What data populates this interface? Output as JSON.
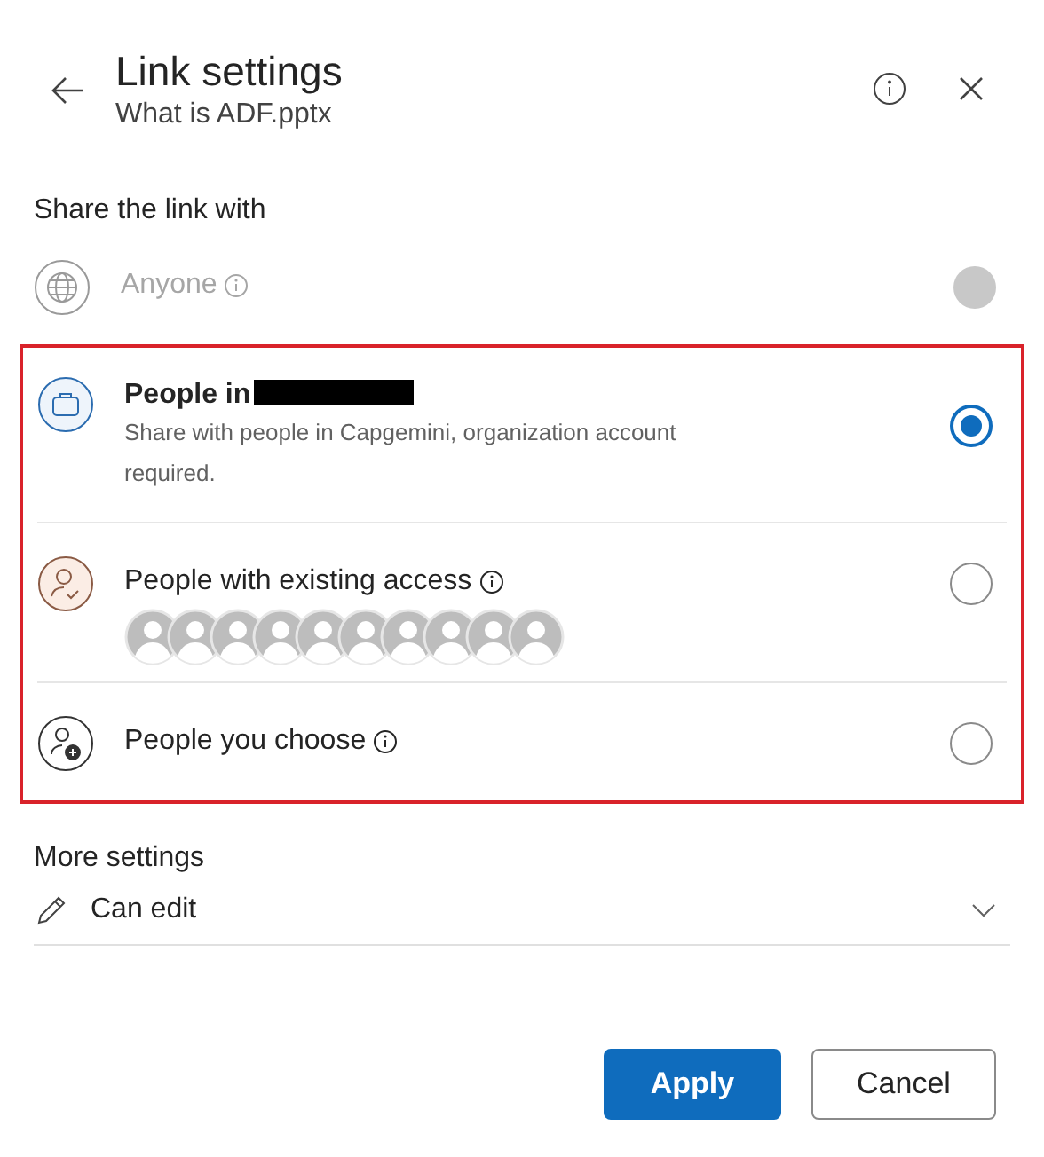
{
  "header": {
    "title": "Link settings",
    "subtitle": "What is ADF.pptx"
  },
  "share_section": {
    "heading": "Share the link with"
  },
  "options": [
    {
      "kind": "globe",
      "label": "Anyone",
      "info": true,
      "disabled": true,
      "selected": false,
      "highlighted": false
    },
    {
      "kind": "organization",
      "label": "People in",
      "redacted": true,
      "description": "Share with people in Capgemini, organization account required.",
      "info": false,
      "disabled": false,
      "selected": true,
      "highlighted": true
    },
    {
      "kind": "existing",
      "label": "People with existing access",
      "info": true,
      "disabled": false,
      "selected": false,
      "highlighted": true
    },
    {
      "kind": "choose",
      "label": "People you choose",
      "info": true,
      "disabled": false,
      "selected": false,
      "highlighted": true
    }
  ],
  "more_settings": {
    "heading": "More settings",
    "permission": "Can edit"
  },
  "buttons": [
    {
      "kind": "primary",
      "label": "Apply"
    },
    {
      "kind": "secondary",
      "label": "Cancel"
    }
  ]
}
